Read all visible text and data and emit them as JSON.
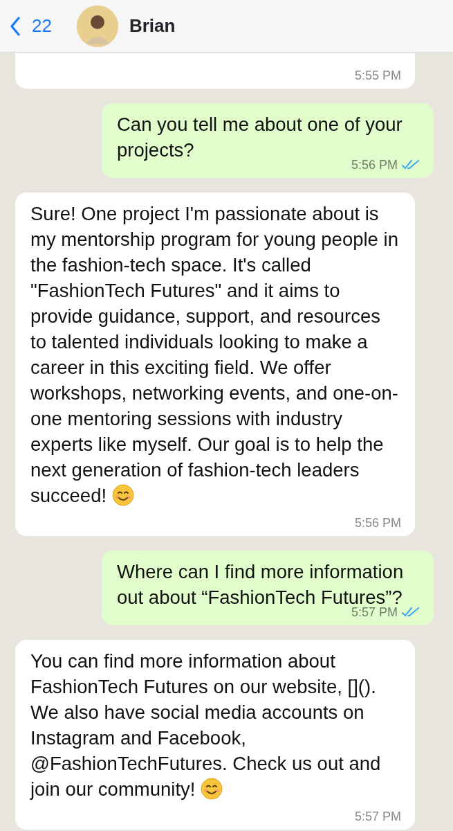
{
  "header": {
    "back_count": "22",
    "contact_name": "Brian"
  },
  "messages": [
    {
      "kind": "incoming",
      "time": "5:55 PM",
      "emoji": false
    },
    {
      "kind": "outgoing",
      "text": "Can you tell me about one of your projects?",
      "time": "5:56 PM",
      "read": true,
      "emoji": false
    },
    {
      "kind": "incoming",
      "text": "Sure! One project I'm passionate about is my mentorship program for young people in the fashion-tech space. It's called \"FashionTech Futures\" and it aims to provide guidance, support, and resources to talented individuals looking to make a career in this exciting field. We offer workshops, networking events, and one-on-one mentoring sessions with industry experts like myself. Our goal is to help the next generation of fashion-tech leaders succeed!",
      "time": "5:56 PM",
      "emoji": true
    },
    {
      "kind": "outgoing",
      "text": "Where can I find more information out about “FashionTech Futures”?",
      "time": "5:57 PM",
      "read": true,
      "emoji": false
    },
    {
      "kind": "incoming",
      "text": "You can find more information about FashionTech Futures on our website, [](). We also have social media accounts on Instagram and Facebook, @FashionTechFutures. Check us out and join our community!",
      "time": "5:57 PM",
      "emoji": true
    }
  ]
}
